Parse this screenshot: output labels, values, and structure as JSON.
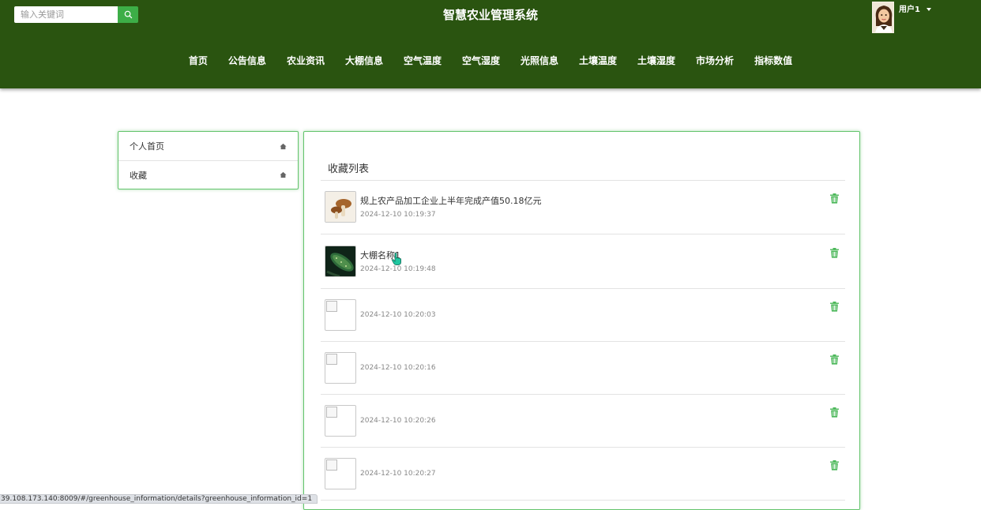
{
  "header": {
    "title": "智慧农业管理系统",
    "search_placeholder": "输入关键词",
    "username": "用户1",
    "background_color": "#2a5410",
    "accent_color": "#3dae47"
  },
  "nav": {
    "items": [
      "首页",
      "公告信息",
      "农业资讯",
      "大棚信息",
      "空气温度",
      "空气湿度",
      "光照信息",
      "土壤温度",
      "土壤湿度",
      "市场分析",
      "指标数值"
    ]
  },
  "sidebar": {
    "items": [
      {
        "label": "个人首页",
        "icon": "home-icon"
      },
      {
        "label": "收藏",
        "icon": "home-icon"
      }
    ]
  },
  "favorites": {
    "title": "收藏列表",
    "items": [
      {
        "title": "规上农产品加工企业上半年完成产值50.18亿元",
        "time": "2024-12-10 10:19:37",
        "image": "mushroom"
      },
      {
        "title": "大棚名称1",
        "time": "2024-12-10 10:19:48",
        "image": "cucumber"
      },
      {
        "title": "",
        "time": "2024-12-10 10:20:03",
        "image": "broken"
      },
      {
        "title": "",
        "time": "2024-12-10 10:20:16",
        "image": "broken"
      },
      {
        "title": "",
        "time": "2024-12-10 10:20:26",
        "image": "broken"
      },
      {
        "title": "",
        "time": "2024-12-10 10:20:27",
        "image": "broken"
      }
    ]
  },
  "status_bar": {
    "url": "39.108.173.140:8009/#/greenhouse_information/details?greenhouse_information_id=1"
  }
}
